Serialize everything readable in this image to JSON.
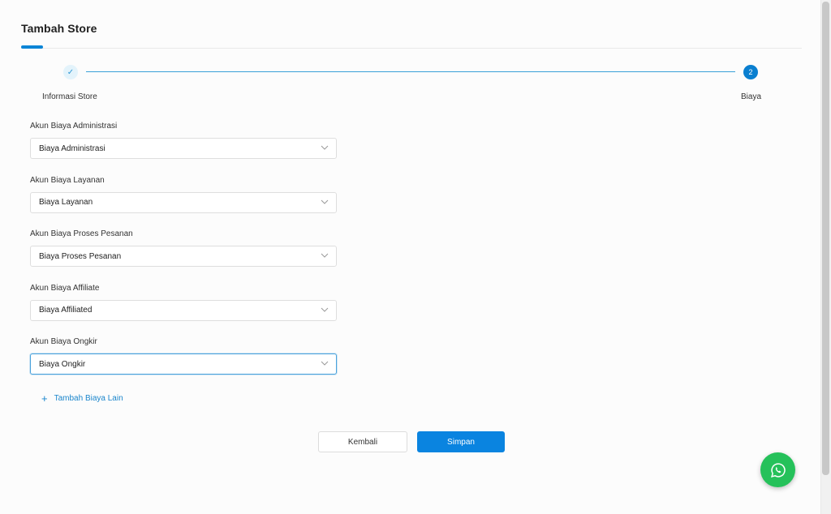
{
  "header": {
    "title": "Tambah Store"
  },
  "stepper": {
    "steps": [
      {
        "label": "Informasi Store",
        "status": "completed",
        "marker": "✓"
      },
      {
        "label": "Biaya",
        "status": "active",
        "marker": "2"
      }
    ]
  },
  "form": {
    "fields": [
      {
        "label": "Akun Biaya Administrasi",
        "value": "Biaya Administrasi"
      },
      {
        "label": "Akun Biaya Layanan",
        "value": "Biaya Layanan"
      },
      {
        "label": "Akun Biaya Proses Pesanan",
        "value": "Biaya Proses Pesanan"
      },
      {
        "label": "Akun Biaya Affiliate",
        "value": "Biaya Affiliated"
      },
      {
        "label": "Akun Biaya Ongkir",
        "value": "Biaya Ongkir"
      }
    ],
    "add_link": "Tambah Biaya Lain",
    "add_icon": "+"
  },
  "actions": {
    "back_label": "Kembali",
    "save_label": "Simpan"
  },
  "colors": {
    "primary": "#0a84e0",
    "whatsapp": "#25c15a",
    "link": "#1b86cc"
  },
  "icons": {
    "step_done": "check-icon",
    "select": "chevron-down-icon",
    "add": "plus-icon",
    "floating": "whatsapp-icon"
  }
}
